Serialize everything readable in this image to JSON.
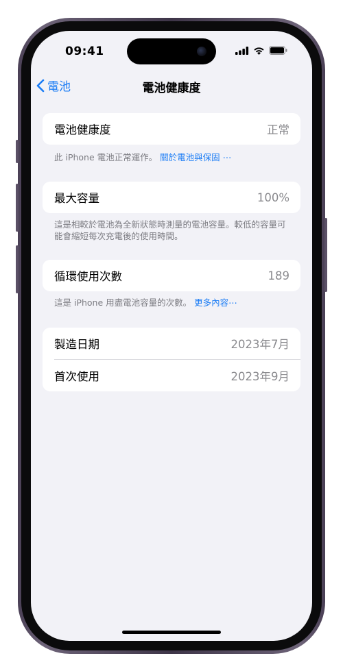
{
  "status_bar": {
    "time": "09:41",
    "icons": [
      "signal-icon",
      "wifi-icon",
      "battery-icon"
    ]
  },
  "nav": {
    "back_label": "電池",
    "title": "電池健康度"
  },
  "sections": {
    "health": {
      "label": "電池健康度",
      "value": "正常",
      "footer_text": "此 iPhone 電池正常運作。",
      "footer_link": "關於電池與保固 ⋯"
    },
    "capacity": {
      "label": "最大容量",
      "value": "100%",
      "footer_text": "這是相較於電池為全新狀態時測量的電池容量。較低的容量可能會縮短每次充電後的使用時間。"
    },
    "cycles": {
      "label": "循環使用次數",
      "value": "189",
      "footer_text": "這是 iPhone 用盡電池容量的次數。",
      "footer_link": "更多內容⋯"
    },
    "dates": {
      "manufacture_label": "製造日期",
      "manufacture_value": "2023年7月",
      "first_use_label": "首次使用",
      "first_use_value": "2023年9月"
    }
  },
  "colors": {
    "accent": "#1a7cf5",
    "background": "#f2f2f7",
    "frame": "#4a3f55"
  }
}
